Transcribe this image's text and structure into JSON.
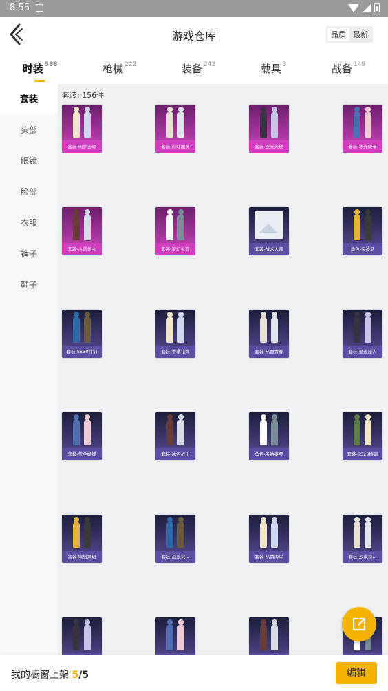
{
  "status_bar": {
    "time": "8:55"
  },
  "header": {
    "title": "游戏仓库",
    "sort": [
      "品质",
      "最新"
    ],
    "sort_active": 0
  },
  "tabs": [
    {
      "label": "时装",
      "count": "588",
      "active": true
    },
    {
      "label": "枪械",
      "count": "222"
    },
    {
      "label": "装备",
      "count": "242"
    },
    {
      "label": "载具",
      "count": "3"
    },
    {
      "label": "战备",
      "count": "149"
    }
  ],
  "sidebar": {
    "items": [
      "套装",
      "头部",
      "眼镜",
      "脸部",
      "衣服",
      "裤子",
      "鞋子"
    ],
    "active": 0
  },
  "content": {
    "set_count": "套装: 156件",
    "items": [
      {
        "label": "套装-闲梦吉缘",
        "tier": "purple"
      },
      {
        "label": "套装-彩虹魔灵",
        "tier": "purple"
      },
      {
        "label": "套装-圣光天使",
        "tier": "purple"
      },
      {
        "label": "套装-寒光使者",
        "tier": "purple"
      },
      {
        "label": "套装-古堡领主",
        "tier": "purple"
      },
      {
        "label": "套装-梦幻火箭",
        "tier": "purple"
      },
      {
        "label": "套装-战术大师",
        "tier": "blue",
        "placeholder": true
      },
      {
        "label": "角色-海琴烟",
        "tier": "blue"
      },
      {
        "label": "套装-SS30特训",
        "tier": "blue"
      },
      {
        "label": "套装-香橘花海",
        "tier": "blue"
      },
      {
        "label": "套装-热血青春",
        "tier": "blue"
      },
      {
        "label": "套装-星迹旅人",
        "tier": "blue"
      },
      {
        "label": "套装-萝兰蝴蝶",
        "tier": "blue"
      },
      {
        "label": "套装-冰河战士",
        "tier": "blue"
      },
      {
        "label": "角色-多纳泰罗",
        "tier": "blue"
      },
      {
        "label": "套装-SS29特训",
        "tier": "blue"
      },
      {
        "label": "套装-缤纷果语",
        "tier": "blue"
      },
      {
        "label": "套装-战痕突...",
        "tier": "blue"
      },
      {
        "label": "套装-热情海岸",
        "tier": "blue"
      },
      {
        "label": "套装-沙漠探...",
        "tier": "blue"
      },
      {
        "label": "",
        "tier": "blue"
      },
      {
        "label": "",
        "tier": "blue"
      },
      {
        "label": "",
        "tier": "blue"
      },
      {
        "label": "",
        "tier": "blue"
      }
    ]
  },
  "bottom_bar": {
    "shelf_label": "我的橱窗上架",
    "shelf_current": "5",
    "shelf_total": "/5",
    "edit_label": "编辑"
  },
  "colors": {
    "accent": "#f5b300",
    "purple_tier": "#d43cc0",
    "blue_tier": "#5b4fa3"
  }
}
